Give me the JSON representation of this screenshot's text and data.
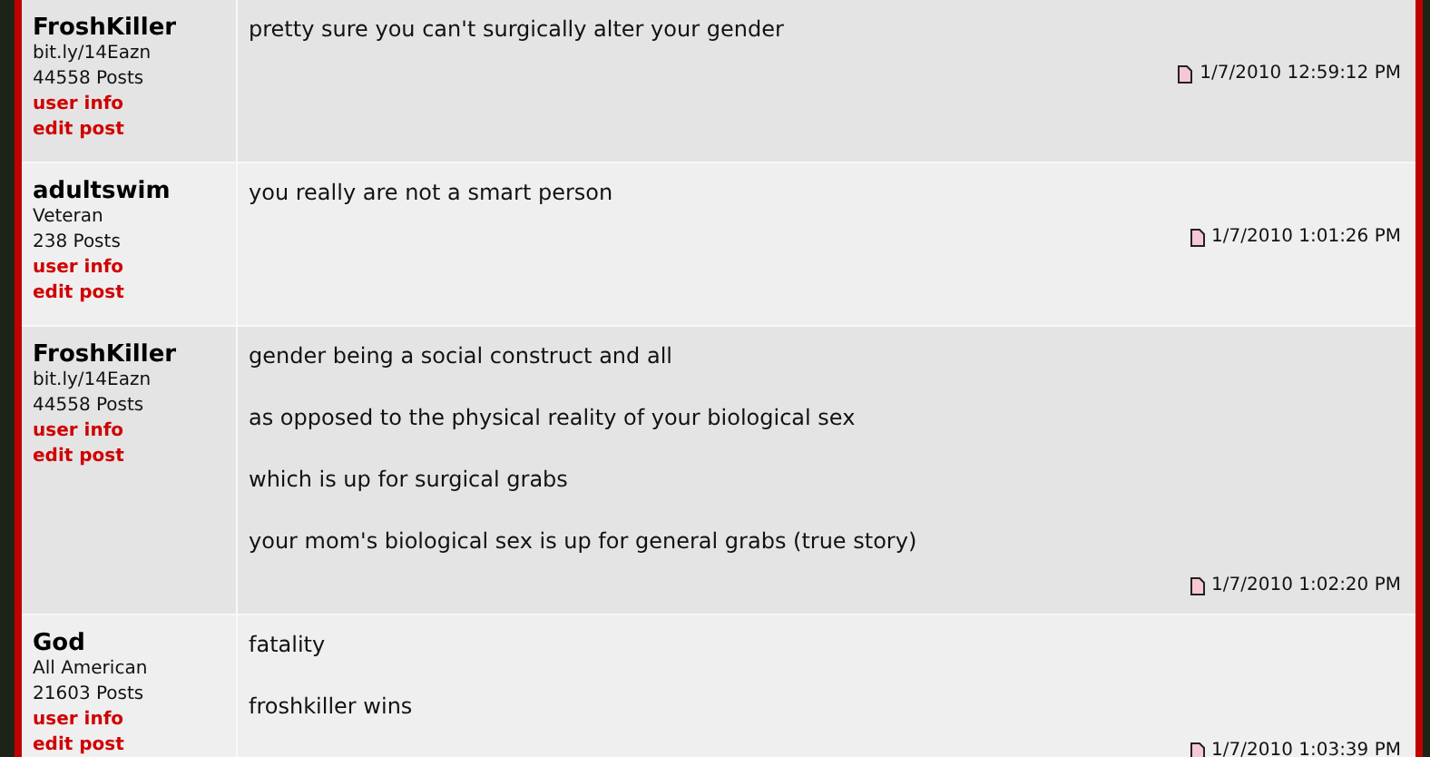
{
  "posts": [
    {
      "author": "FroshKiller",
      "title": "bit.ly/14Eazn",
      "post_count": "44558 Posts",
      "links": [
        "user info",
        "edit post"
      ],
      "paragraphs": [
        "pretty sure you can't surgically alter your gender"
      ],
      "timestamp": "1/7/2010 12:59:12 PM"
    },
    {
      "author": "adultswim",
      "title": "Veteran",
      "post_count": "238 Posts",
      "links": [
        "user info",
        "edit post"
      ],
      "paragraphs": [
        "you really are not a smart person"
      ],
      "timestamp": "1/7/2010 1:01:26 PM"
    },
    {
      "author": "FroshKiller",
      "title": "bit.ly/14Eazn",
      "post_count": "44558 Posts",
      "links": [
        "user info",
        "edit post"
      ],
      "paragraphs": [
        "gender being a social construct and all",
        "as opposed to the physical reality of your biological sex",
        "which is up for surgical grabs",
        "your mom's biological sex is up for general grabs (true story)"
      ],
      "timestamp": "1/7/2010 1:02:20 PM"
    },
    {
      "author": "God",
      "title": "All American",
      "post_count": "21603 Posts",
      "links": [
        "user info",
        "edit post"
      ],
      "paragraphs": [
        "fatality",
        "froshkiller wins"
      ],
      "timestamp": "1/7/2010 1:03:39 PM"
    }
  ]
}
